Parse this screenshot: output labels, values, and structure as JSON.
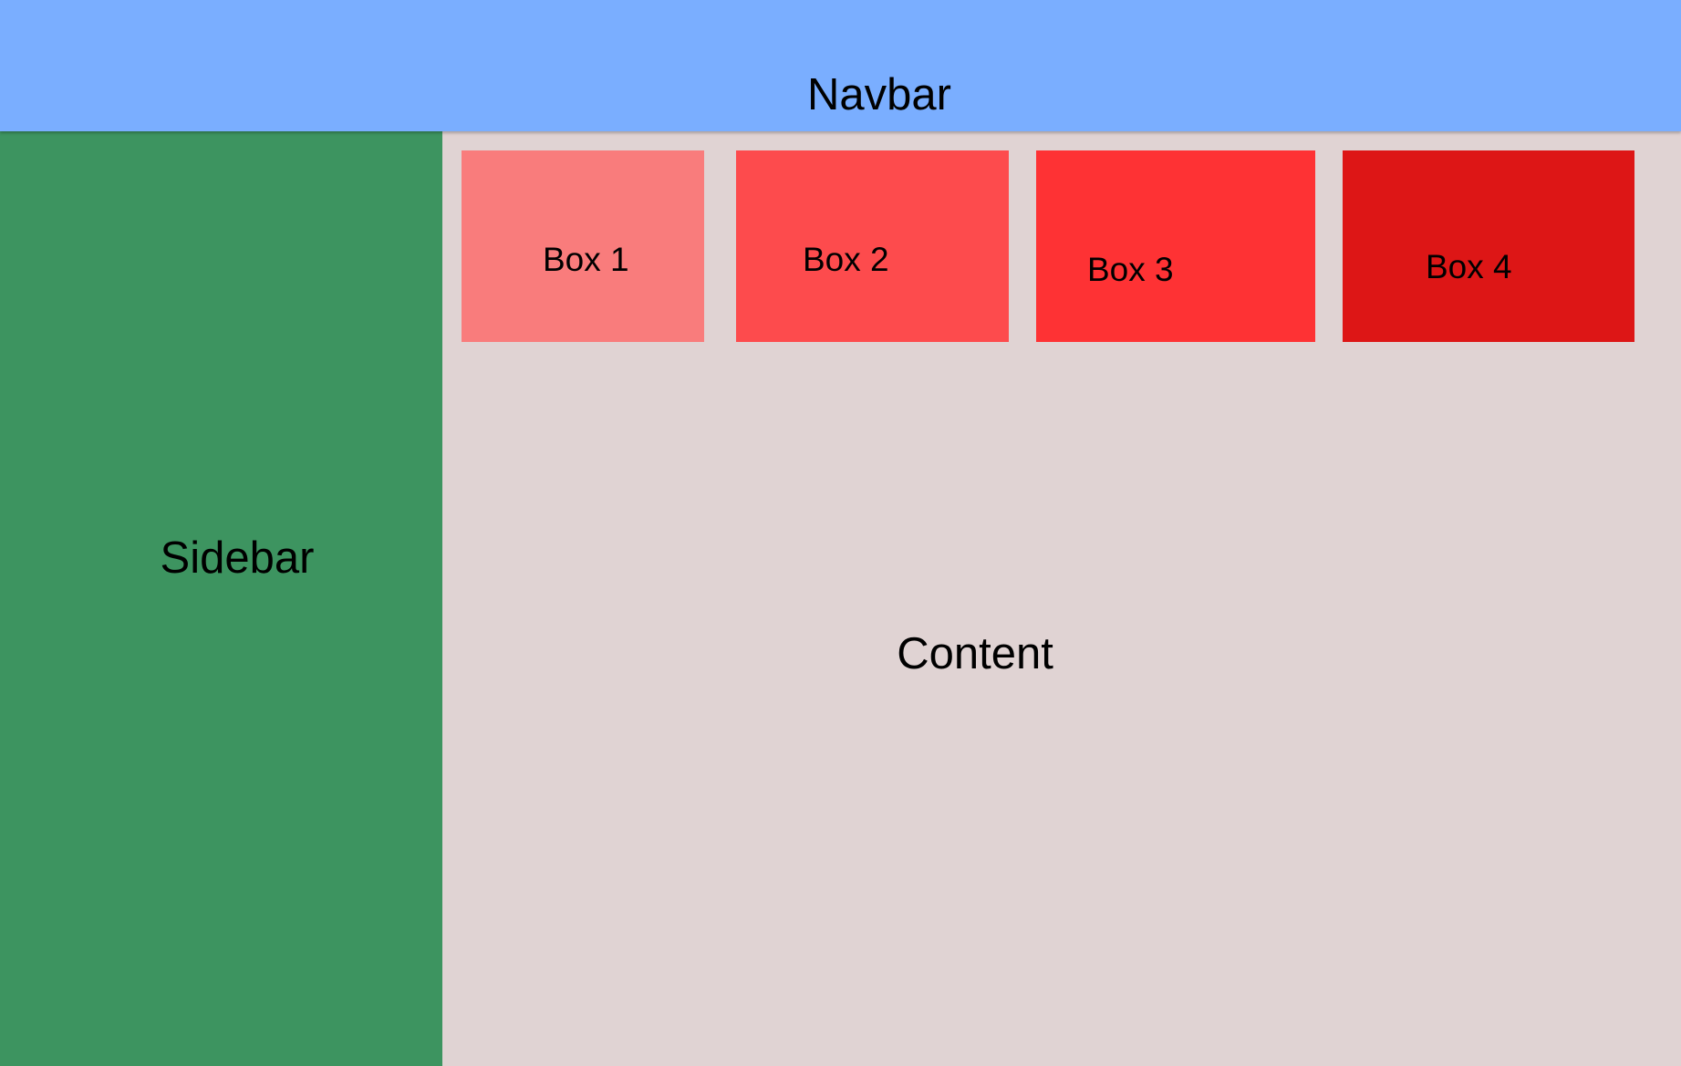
{
  "navbar": {
    "title": "Navbar"
  },
  "sidebar": {
    "title": "Sidebar"
  },
  "content": {
    "title": "Content"
  },
  "boxes": [
    {
      "label": "Box 1",
      "color": "#f97c7c"
    },
    {
      "label": "Box 2",
      "color": "#fd4b4d"
    },
    {
      "label": "Box 3",
      "color": "#fe3234"
    },
    {
      "label": "Box 4",
      "color": "#dd1616"
    }
  ],
  "colors": {
    "navbar": "#7aaeff",
    "sidebar": "#3d9460",
    "content": "#e0d3d3"
  }
}
